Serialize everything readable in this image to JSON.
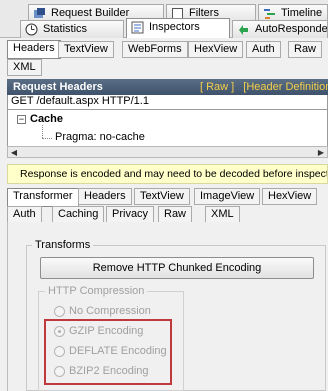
{
  "top_tabs": {
    "row1": [
      {
        "label": "Request Builder",
        "icon": "request-builder-icon"
      },
      {
        "label": "Filters",
        "icon": "checkbox-icon"
      },
      {
        "label": "Timeline",
        "icon": "timeline-icon"
      }
    ],
    "row2": [
      {
        "label": "Statistics",
        "icon": "statistics-icon"
      },
      {
        "label": "Inspectors",
        "icon": "inspectors-icon"
      },
      {
        "label": "AutoResponder",
        "icon": "autoresponder-icon"
      }
    ]
  },
  "request_tabs": [
    "Headers",
    "TextView",
    "WebForms",
    "HexView",
    "Auth",
    "Raw",
    "XML"
  ],
  "request_headers": {
    "title": "Request Headers",
    "raw_link": "[ Raw ]",
    "defs_link": "[Header Definitions]",
    "request_line": "GET /default.aspx HTTP/1.1",
    "group": "Cache",
    "header": "Pragma: no-cache"
  },
  "notice": "Response is encoded and may need to be decoded before inspection.",
  "response_tabs_row1": [
    "Transformer",
    "Headers",
    "TextView",
    "ImageView",
    "HexView"
  ],
  "response_tabs_row2": [
    "Auth",
    "Caching",
    "Privacy",
    "Raw",
    "XML"
  ],
  "transforms": {
    "group_label": "Transforms",
    "remove_chunked_button": "Remove HTTP Chunked Encoding",
    "compression_label": "HTTP Compression",
    "options": [
      "No Compression",
      "GZIP Encoding",
      "DEFLATE Encoding",
      "BZIP2 Encoding"
    ]
  },
  "colors": {
    "header_bar": "#4a5e78",
    "link": "#f5d049",
    "notice_bg": "#ffffc9",
    "highlight": "#c0393a"
  }
}
